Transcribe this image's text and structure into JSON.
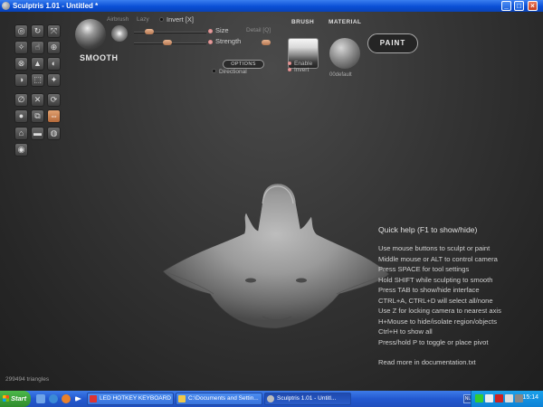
{
  "window": {
    "title": "Sculptris 1.01 - Untitled *",
    "minimize_glyph": "_",
    "maximize_glyph": "□",
    "close_glyph": "×"
  },
  "toolbar": {
    "brush_name": "SMOOTH",
    "airbrush_label": "Airbrush",
    "lazy_label": "Lazy",
    "invert_label": "Invert [X]",
    "size_label": "Size",
    "detail_label": "Detail [Q]",
    "strength_label": "Strength",
    "options_label": "OPTIONS",
    "directional_label": "Directional",
    "brush_heading": "BRUSH",
    "enable_label": "Enable",
    "invert2_label": "Invert",
    "material_heading": "MATERIAL",
    "material_name": "00default",
    "paint_label": "PAINT"
  },
  "tools": [
    "◎",
    "↻",
    "⤧",
    "✧",
    "☝",
    "⊕",
    "⊗",
    "▲",
    "◐",
    "◑",
    "⬚",
    "✦",
    "∅",
    "✕",
    "⟳",
    "⇔",
    "●",
    "⧉",
    "⌂",
    "▬",
    "◍",
    "◉"
  ],
  "quick_help": {
    "title": "Quick help (F1 to show/hide)",
    "lines": [
      "Use mouse buttons to sculpt or paint",
      "Middle mouse or ALT to control camera",
      "Press SPACE for tool settings",
      "Hold SHIFT while sculpting to smooth",
      "Press TAB to show/hide interface",
      "CTRL+A, CTRL+D will select all/none",
      "Use Z for locking camera to nearest axis",
      "H+Mouse to hide/isolate region/objects",
      "Ctrl+H to show all",
      "Press/hold P to toggle or place pivot"
    ],
    "footer": "Read more in documentation.txt"
  },
  "status": {
    "triangles": "299494 triangles"
  },
  "taskbar": {
    "start_label": "Start",
    "tasks": [
      {
        "label": "LED HOTKEY KEYBOARD",
        "active": false
      },
      {
        "label": "C:\\Documents and Settin...",
        "active": false
      },
      {
        "label": "Sculptris 1.01 - Untitl...",
        "active": true
      }
    ],
    "language": "NL",
    "clock": "15:14"
  },
  "colors": {
    "accent_orange": "#d9895a",
    "background": "#333333",
    "titlebar_blue": "#0a4fd6"
  }
}
